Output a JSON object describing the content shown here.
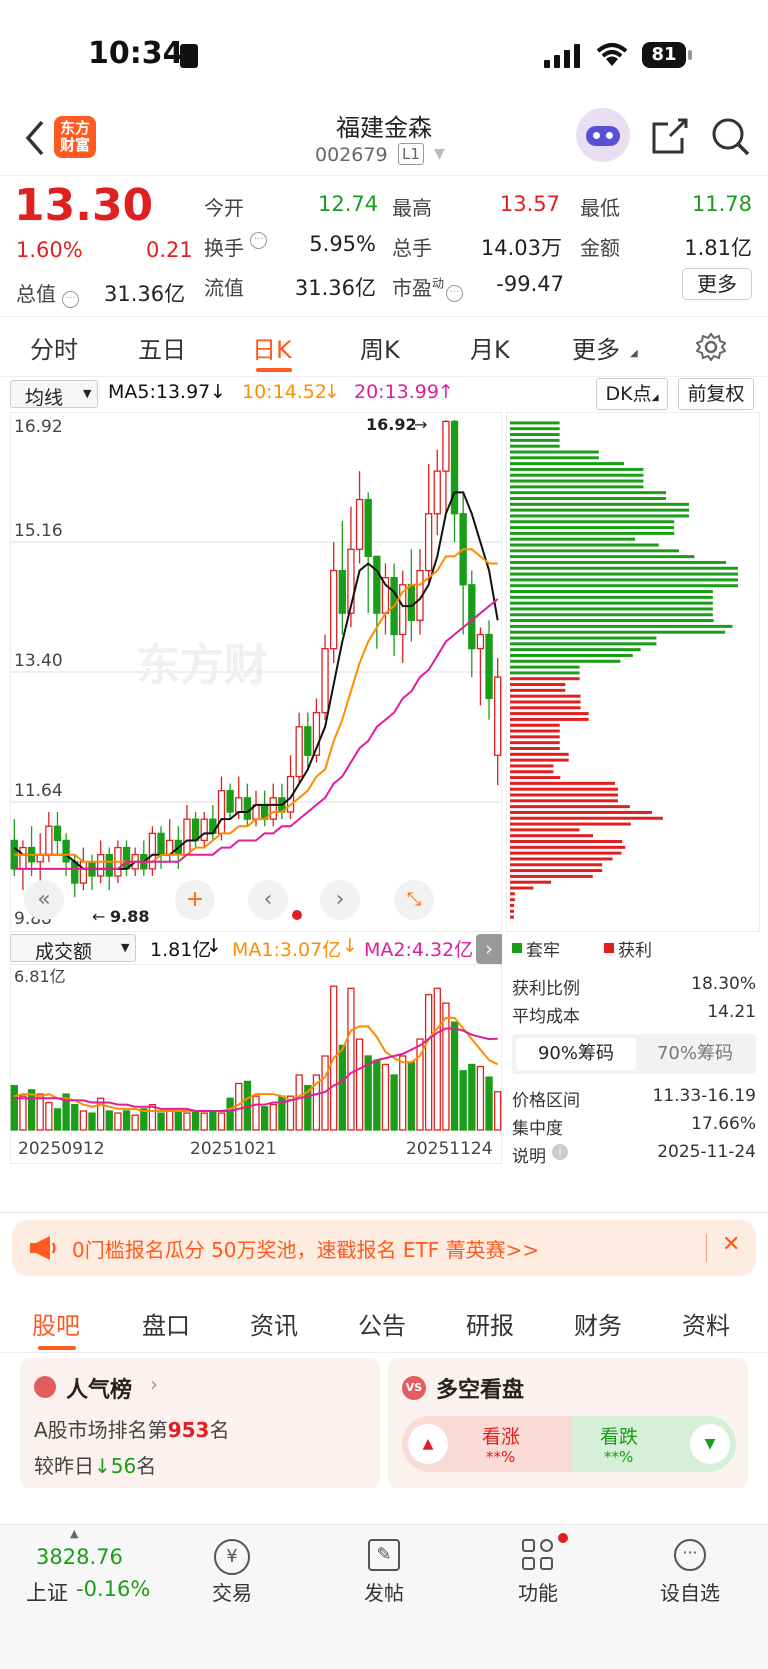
{
  "status_bar": {
    "time": "10:34",
    "battery": "81"
  },
  "header": {
    "stock_name": "福建金森",
    "stock_code": "002679",
    "level_badge": "L1",
    "logo_text": "东方财富"
  },
  "quote": {
    "price": "13.30",
    "change_pct": "1.60%",
    "change": "0.21",
    "open_label": "今开",
    "open": "12.74",
    "high_label": "最高",
    "high": "13.57",
    "low_label": "最低",
    "low": "11.78",
    "turnover_label": "换手",
    "turnover": "5.95%",
    "volume_label": "总手",
    "volume": "14.03万",
    "amount_label": "金额",
    "amount": "1.81亿",
    "mktcap_label": "总值",
    "mktcap": "31.36亿",
    "float_label": "流值",
    "float": "31.36亿",
    "pe_label": "市盈",
    "pe_sup": "动",
    "pe": "-99.47",
    "more": "更多"
  },
  "period_tabs": [
    "分时",
    "五日",
    "日K",
    "周K",
    "月K",
    "更多"
  ],
  "active_tab": "日K",
  "ma_bar": {
    "indicator": "均线",
    "ma5": "MA5:13.97",
    "ma10": "10:14.52",
    "ma20": "20:13.99",
    "dk": "DK点",
    "adjust": "前复权"
  },
  "price_axis": [
    "16.92",
    "15.16",
    "13.40",
    "11.64",
    "9.88"
  ],
  "annotations": {
    "high": "16.92",
    "low": "9.88"
  },
  "watermark": "东方财",
  "volume_bar": {
    "indicator": "成交额",
    "value": "1.81亿",
    "ma1": "MA1:3.07亿",
    "ma2": "MA2:4.32亿",
    "axis_top": "6.81亿"
  },
  "dates": [
    "20250912",
    "20251021",
    "20251124"
  ],
  "chips": {
    "legend_trapped": "套牢",
    "legend_profit": "获利",
    "profit_ratio_label": "获利比例",
    "profit_ratio": "18.30%",
    "avg_cost_label": "平均成本",
    "avg_cost": "14.21",
    "tab90": "90%筹码",
    "tab70": "70%筹码",
    "range_label": "价格区间",
    "range": "11.33-16.19",
    "concentration_label": "集中度",
    "concentration": "17.66%",
    "note_label": "说明",
    "note_date": "2025-11-24"
  },
  "banner": "0门槛报名瓜分 50万奖池，速戳报名 ETF 菁英赛>>",
  "section_tabs": [
    "股吧",
    "盘口",
    "资讯",
    "公告",
    "研报",
    "财务",
    "资料"
  ],
  "popularity": {
    "title": "人气榜",
    "rank_prefix": "A股市场排名第",
    "rank": "953",
    "rank_suffix": "名",
    "change_prefix": "较昨日",
    "change": "56",
    "change_suffix": "名"
  },
  "bull_bear": {
    "title": "多空看盘",
    "bull": "看涨",
    "bull_pct": "**%",
    "bear": "看跌",
    "bear_pct": "**%"
  },
  "bottom_nav": {
    "index_value": "3828.76",
    "index_name": "上证",
    "index_change": "-0.16%",
    "items": [
      "交易",
      "发帖",
      "功能",
      "设自选"
    ]
  },
  "colors": {
    "up": "#e02020",
    "down": "#1a9e1a",
    "accent": "#ff6a00",
    "ma5": "#111111",
    "ma10": "#ff8c00",
    "ma20": "#e01e9a"
  },
  "chart_data": {
    "type": "candlestick",
    "ylim": [
      9.88,
      16.92
    ],
    "candles": [
      [
        11.0,
        10.6,
        11.3,
        10.5
      ],
      [
        10.6,
        10.9,
        11.0,
        10.3
      ],
      [
        10.9,
        10.7,
        11.2,
        10.5
      ],
      [
        10.7,
        10.8,
        11.1,
        10.4
      ],
      [
        10.8,
        11.2,
        11.4,
        10.7
      ],
      [
        11.2,
        11.0,
        11.4,
        10.8
      ],
      [
        11.0,
        10.7,
        11.1,
        10.5
      ],
      [
        10.7,
        10.4,
        10.8,
        10.2
      ],
      [
        10.4,
        10.7,
        10.9,
        10.3
      ],
      [
        10.7,
        10.5,
        10.8,
        10.3
      ],
      [
        10.5,
        10.8,
        11.0,
        10.4
      ],
      [
        10.8,
        10.5,
        10.9,
        10.3
      ],
      [
        10.5,
        10.9,
        11.0,
        10.4
      ],
      [
        10.9,
        10.6,
        11.0,
        10.5
      ],
      [
        10.6,
        10.8,
        10.9,
        10.5
      ],
      [
        10.8,
        10.6,
        11.0,
        10.5
      ],
      [
        10.6,
        11.1,
        11.2,
        10.5
      ],
      [
        11.1,
        10.8,
        11.2,
        10.6
      ],
      [
        10.8,
        11.0,
        11.3,
        10.7
      ],
      [
        11.0,
        10.8,
        11.2,
        10.6
      ],
      [
        10.8,
        11.3,
        11.5,
        10.8
      ],
      [
        11.3,
        11.0,
        11.4,
        10.9
      ],
      [
        11.0,
        11.3,
        11.4,
        10.9
      ],
      [
        11.3,
        11.1,
        11.5,
        11.0
      ],
      [
        11.1,
        11.7,
        11.9,
        11.0
      ],
      [
        11.7,
        11.4,
        11.8,
        11.3
      ],
      [
        11.4,
        11.6,
        11.9,
        11.3
      ],
      [
        11.6,
        11.3,
        11.8,
        11.2
      ],
      [
        11.3,
        11.5,
        11.7,
        11.2
      ],
      [
        11.5,
        11.3,
        11.7,
        11.2
      ],
      [
        11.3,
        11.6,
        11.8,
        11.2
      ],
      [
        11.6,
        11.4,
        11.8,
        11.3
      ],
      [
        11.4,
        11.9,
        12.2,
        11.3
      ],
      [
        11.9,
        12.6,
        12.8,
        11.8
      ],
      [
        12.6,
        12.2,
        12.8,
        12.0
      ],
      [
        12.2,
        12.8,
        13.0,
        12.1
      ],
      [
        12.8,
        13.7,
        13.9,
        12.7
      ],
      [
        13.7,
        14.8,
        15.2,
        13.5
      ],
      [
        14.8,
        14.2,
        15.5,
        13.9
      ],
      [
        14.2,
        15.1,
        15.7,
        14.0
      ],
      [
        15.1,
        15.8,
        16.2,
        14.9
      ],
      [
        15.8,
        15.0,
        15.9,
        14.2
      ],
      [
        15.0,
        14.2,
        15.0,
        13.7
      ],
      [
        14.2,
        14.7,
        14.9,
        13.9
      ],
      [
        14.7,
        13.9,
        14.9,
        13.6
      ],
      [
        13.9,
        14.6,
        14.8,
        13.5
      ],
      [
        14.6,
        14.1,
        15.1,
        13.8
      ],
      [
        14.1,
        14.8,
        15.1,
        13.9
      ],
      [
        14.8,
        15.6,
        16.3,
        14.6
      ],
      [
        15.6,
        16.2,
        16.5,
        15.3
      ],
      [
        16.2,
        16.9,
        16.92,
        15.6
      ],
      [
        16.9,
        15.6,
        16.92,
        15.2
      ],
      [
        15.6,
        14.6,
        15.9,
        13.9
      ],
      [
        14.6,
        13.7,
        14.8,
        13.3
      ],
      [
        13.7,
        13.9,
        14.0,
        12.9
      ],
      [
        13.9,
        13.0,
        14.1,
        12.7
      ],
      [
        12.2,
        13.3,
        13.57,
        11.78
      ]
    ],
    "ma5": [
      10.9,
      10.8,
      10.8,
      10.8,
      10.8,
      10.8,
      10.8,
      10.7,
      10.6,
      10.6,
      10.6,
      10.6,
      10.6,
      10.6,
      10.7,
      10.7,
      10.8,
      10.8,
      10.8,
      10.9,
      11.0,
      11.0,
      11.1,
      11.1,
      11.3,
      11.3,
      11.4,
      11.4,
      11.5,
      11.5,
      11.5,
      11.5,
      11.6,
      11.8,
      12.0,
      12.3,
      12.6,
      13.2,
      13.8,
      14.3,
      14.8,
      14.9,
      14.8,
      14.6,
      14.5,
      14.3,
      14.3,
      14.4,
      14.6,
      15.0,
      15.6,
      15.9,
      15.9,
      15.6,
      15.2,
      14.8,
      14.1
    ],
    "ma10": [
      10.8,
      10.8,
      10.8,
      10.8,
      10.8,
      10.8,
      10.8,
      10.8,
      10.7,
      10.7,
      10.7,
      10.7,
      10.7,
      10.7,
      10.7,
      10.7,
      10.7,
      10.8,
      10.8,
      10.8,
      10.8,
      10.9,
      10.9,
      11.0,
      11.1,
      11.1,
      11.2,
      11.2,
      11.3,
      11.3,
      11.4,
      11.4,
      11.5,
      11.6,
      11.7,
      11.9,
      12.0,
      12.4,
      12.7,
      13.1,
      13.5,
      13.8,
      14.0,
      14.2,
      14.3,
      14.5,
      14.6,
      14.6,
      14.7,
      14.8,
      15.0,
      15.0,
      15.1,
      15.1,
      15.0,
      14.9,
      14.9
    ],
    "ma20": [
      10.6,
      10.6,
      10.6,
      10.6,
      10.6,
      10.6,
      10.6,
      10.6,
      10.6,
      10.6,
      10.6,
      10.6,
      10.6,
      10.7,
      10.7,
      10.7,
      10.7,
      10.7,
      10.7,
      10.7,
      10.8,
      10.8,
      10.8,
      10.8,
      10.9,
      10.9,
      11.0,
      11.0,
      11.0,
      11.1,
      11.1,
      11.2,
      11.2,
      11.3,
      11.4,
      11.5,
      11.6,
      11.8,
      11.9,
      12.1,
      12.3,
      12.4,
      12.6,
      12.7,
      12.8,
      13.0,
      13.1,
      13.3,
      13.4,
      13.6,
      13.8,
      13.9,
      14.0,
      14.1,
      14.2,
      14.3,
      14.4
    ],
    "volume_ylim": [
      0,
      6.81
    ],
    "volume": [
      2.1,
      1.6,
      1.9,
      1.7,
      1.3,
      1.0,
      1.7,
      1.2,
      0.9,
      0.8,
      1.5,
      0.9,
      0.8,
      0.9,
      0.7,
      1.0,
      1.2,
      0.8,
      0.9,
      0.9,
      0.8,
      0.9,
      0.8,
      0.9,
      0.8,
      1.5,
      2.2,
      2.3,
      1.6,
      1.1,
      1.2,
      1.6,
      1.6,
      2.6,
      2.1,
      2.6,
      3.5,
      6.8,
      4.0,
      6.7,
      4.3,
      3.5,
      3.3,
      3.1,
      2.6,
      3.5,
      3.2,
      4.3,
      6.4,
      6.7,
      6.0,
      5.1,
      2.8,
      3.1,
      3.0,
      2.5,
      1.81
    ],
    "vol_ma1": [
      1.6,
      1.7,
      1.7,
      1.6,
      1.7,
      1.5,
      1.5,
      1.4,
      1.2,
      1.1,
      1.2,
      1.1,
      1.0,
      1.0,
      1.0,
      0.9,
      0.9,
      0.9,
      0.9,
      0.9,
      0.9,
      0.9,
      0.9,
      0.9,
      0.9,
      1.0,
      1.2,
      1.5,
      1.7,
      1.7,
      1.7,
      1.6,
      1.4,
      1.6,
      1.8,
      2.2,
      2.5,
      3.4,
      3.8,
      4.7,
      4.9,
      4.9,
      4.4,
      3.7,
      3.4,
      3.2,
      3.2,
      3.5,
      4.3,
      4.8,
      5.3,
      5.3,
      4.8,
      4.3,
      3.8,
      3.3,
      3.1
    ],
    "vol_ma2": [
      1.5,
      1.5,
      1.5,
      1.5,
      1.5,
      1.5,
      1.4,
      1.4,
      1.4,
      1.3,
      1.3,
      1.3,
      1.2,
      1.2,
      1.1,
      1.1,
      1.1,
      1.0,
      1.0,
      1.0,
      1.0,
      0.9,
      0.9,
      0.9,
      0.9,
      0.9,
      1.0,
      1.1,
      1.2,
      1.2,
      1.3,
      1.3,
      1.4,
      1.5,
      1.6,
      1.7,
      1.8,
      2.1,
      2.3,
      2.7,
      2.9,
      3.1,
      3.3,
      3.4,
      3.5,
      3.6,
      3.8,
      4.0,
      4.3,
      4.6,
      4.8,
      4.8,
      4.7,
      4.5,
      4.4,
      4.3,
      4.32
    ]
  }
}
